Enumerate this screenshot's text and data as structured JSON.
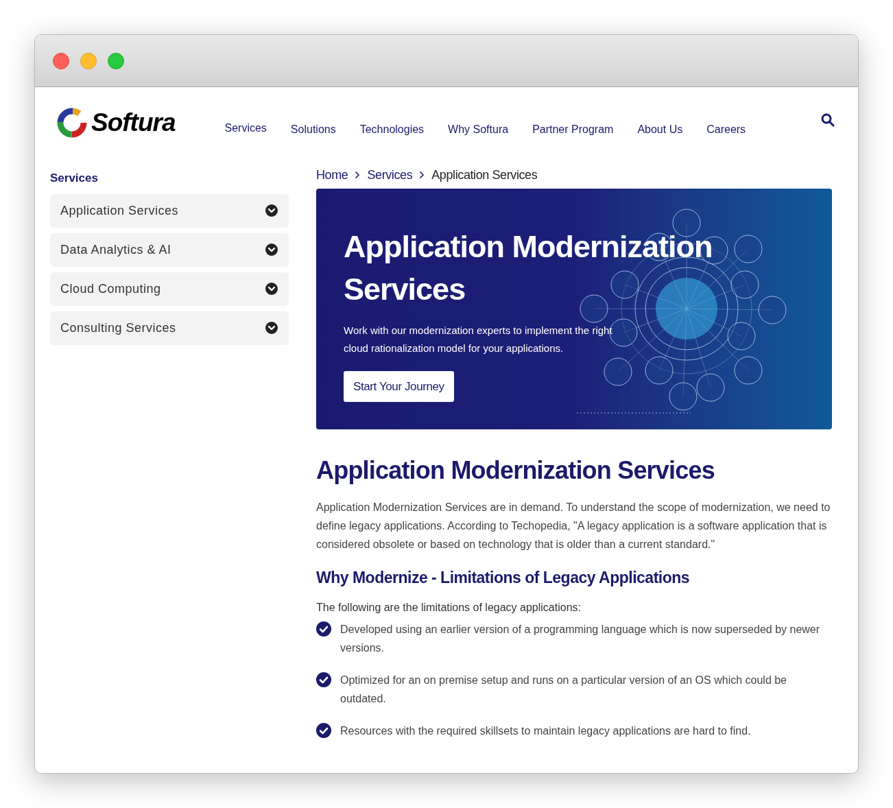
{
  "header": {
    "logo_text": "Softura",
    "nav": [
      "Services",
      "Solutions",
      "Technologies",
      "Why Softura",
      "Partner Program",
      "About Us",
      "Careers"
    ]
  },
  "sidebar": {
    "title": "Services",
    "items": [
      {
        "label": "Application Services",
        "expanded": false
      },
      {
        "label": "Data Analytics & AI",
        "expanded": false
      },
      {
        "label": "Cloud Computing",
        "expanded": false
      },
      {
        "label": "Consulting Services",
        "expanded": false
      }
    ]
  },
  "breadcrumb": [
    {
      "label": "Home",
      "current": false
    },
    {
      "label": "Services",
      "current": false
    },
    {
      "label": "Application Services",
      "current": true
    }
  ],
  "hero": {
    "title": "Application Modernization Services",
    "text": "Work with our modernization experts to implement the right cloud rationalization model for your applications.",
    "button": "Start Your Journey"
  },
  "article": {
    "title": "Application Modernization Services",
    "intro": "Application Modernization Services are in demand. To understand the scope of modernization, we need to define legacy applications. According to Techopedia, \"A legacy application is a software application that is considered obsolete or based on technology that is older than a current standard.\"",
    "subtitle": "Why Modernize - Limitations of Legacy Applications",
    "lead": "The following are the limitations of legacy applications:",
    "bullets": [
      "Developed using an earlier version of a programming language which is now superseded by newer versions.",
      "Optimized for an on premise setup and runs on a particular version of an OS which could be outdated.",
      "Resources with the required skillsets to maintain legacy applications are hard to find."
    ]
  }
}
